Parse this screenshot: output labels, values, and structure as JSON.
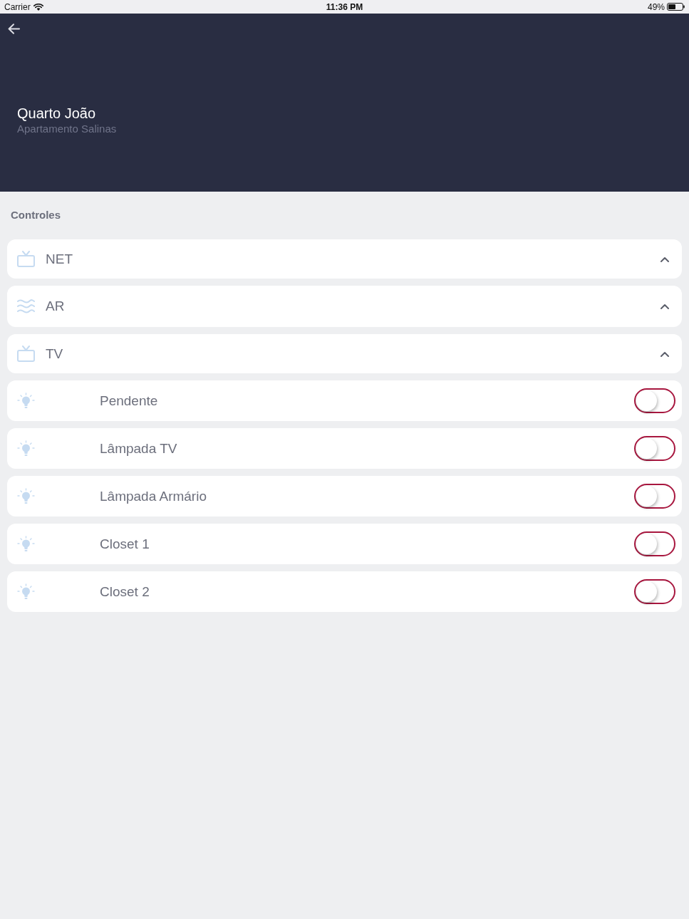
{
  "status_bar": {
    "carrier": "Carrier",
    "time": "11:36 PM",
    "battery": "49%"
  },
  "header": {
    "title": "Quarto João",
    "subtitle": "Apartamento Salinas"
  },
  "section_title": "Controles",
  "controls": [
    {
      "kind": "tv",
      "label": "NET",
      "expanded": true
    },
    {
      "kind": "climate",
      "label": "AR",
      "expanded": true
    },
    {
      "kind": "tv",
      "label": "TV",
      "expanded": true
    },
    {
      "kind": "light",
      "label": "Pendente",
      "on": false
    },
    {
      "kind": "light",
      "label": "Lâmpada TV",
      "on": false
    },
    {
      "kind": "light",
      "label": "Lâmpada Armário",
      "on": false
    },
    {
      "kind": "light",
      "label": "Closet 1",
      "on": false
    },
    {
      "kind": "light",
      "label": "Closet 2",
      "on": false
    }
  ]
}
